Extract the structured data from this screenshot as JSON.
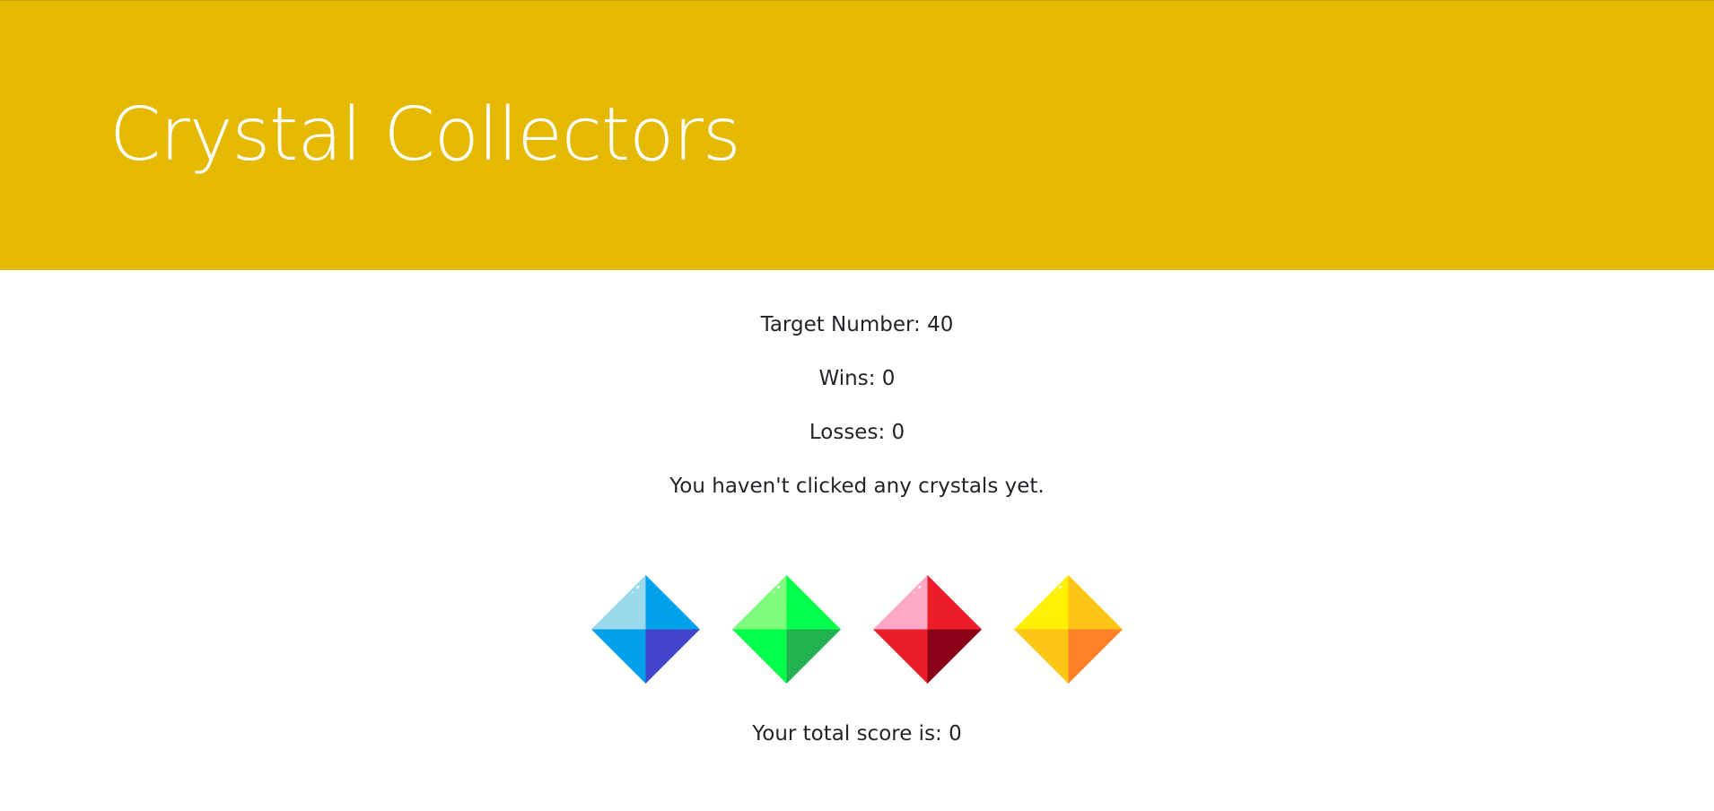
{
  "header": {
    "title": "Crystal Collectors",
    "background_color": "#e5b900"
  },
  "stats": {
    "target": "Target Number: 40",
    "wins": "Wins: 0",
    "losses": "Losses: 0",
    "status": "You haven't clicked any crystals yet."
  },
  "crystals": [
    {
      "name": "blue-crystal-icon",
      "colors": [
        "#9ad8ec",
        "#00a1e8",
        "#00a1e8",
        "#4346cc"
      ]
    },
    {
      "name": "green-crystal-icon",
      "colors": [
        "#7efc7e",
        "#03ff4a",
        "#03ff4a",
        "#23b04f"
      ]
    },
    {
      "name": "red-crystal-icon",
      "colors": [
        "#fda8c6",
        "#ec1c2a",
        "#ec1c2a",
        "#8a0016"
      ]
    },
    {
      "name": "yellow-crystal-icon",
      "colors": [
        "#ffef00",
        "#ffc514",
        "#ffc514",
        "#ff8128"
      ]
    }
  ],
  "score": {
    "label": "Your total score is: 0"
  }
}
